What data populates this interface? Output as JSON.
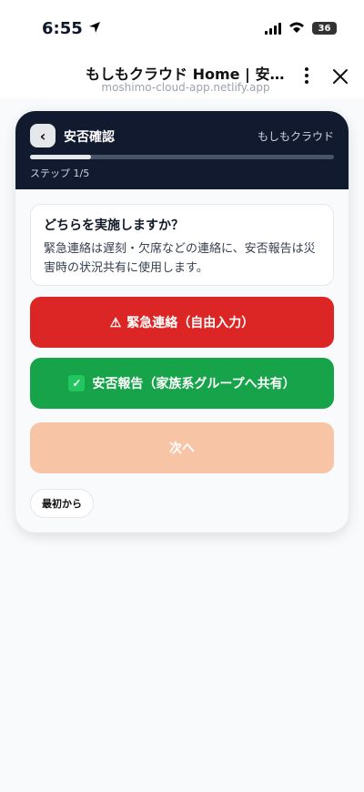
{
  "status_bar": {
    "time": "6:55",
    "battery": "36"
  },
  "browser": {
    "title": "もしもクラウド Home | 安否…",
    "url": "moshimo-cloud-app.netlify.app"
  },
  "card": {
    "back_label": "‹",
    "title": "安否確認",
    "app_name": "もしもクラウド",
    "progress": 0.2,
    "step_text": "ステップ 1/5"
  },
  "info": {
    "title": "どちらを実施しますか？",
    "body": "緊急連絡は遅刻・欠席などの連絡に、安否報告は災害時の状況共有に使用します。"
  },
  "buttons": {
    "emergency": "緊急連絡（自由入力）",
    "safety": "安否報告（家族系グループへ共有）",
    "next": "次へ",
    "restart": "最初から"
  },
  "icons": {
    "emergency": "warning-icon",
    "safety": "check-icon"
  },
  "colors": {
    "emergency": "#dc2626",
    "safety": "#16a34a",
    "next_disabled": "#f7c4a5",
    "header": "#111a2e"
  }
}
